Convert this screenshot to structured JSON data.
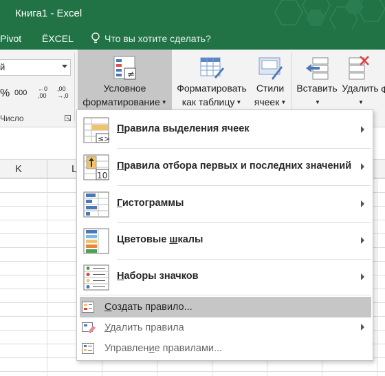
{
  "window": {
    "title": "Книга1 - Excel"
  },
  "tabs": {
    "pivot": "Pivot",
    "excel": "ЁXCEL",
    "tell_me": "Что вы хотите сделать?"
  },
  "ribbon": {
    "number_format_value": "й",
    "percent": "%",
    "thousands": "000",
    "inc_decimal": "←0 ,00",
    "dec_decimal": ",00 →,0",
    "number_group_label": "Число",
    "cond_format": {
      "line1": "Условное",
      "line2": "форматирование"
    },
    "format_table": {
      "line1": "Форматировать",
      "line2": "как таблицу"
    },
    "cell_styles": {
      "line1": "Стили",
      "line2": "ячеек"
    },
    "insert": {
      "label": "Вставить"
    },
    "delete": {
      "label": "Удалить"
    },
    "format": {
      "label": "Ф"
    }
  },
  "columns": [
    "K",
    "L"
  ],
  "menu": {
    "highlight_rules": {
      "label_u": "П",
      "label_rest": "равила выделения ячеек"
    },
    "top_bottom": {
      "label_u": "П",
      "label_rest": "равила отбора первых и последних значений"
    },
    "data_bars": {
      "label_u": "Г",
      "label_rest": "истограммы"
    },
    "color_scales": {
      "label_pre": "Цветовые ",
      "label_u": "ш",
      "label_rest": "калы"
    },
    "icon_sets": {
      "label_u": "Н",
      "label_rest": "аборы значков"
    },
    "new_rule": {
      "label_pre": "",
      "label_u": "С",
      "label_rest": "оздать правило..."
    },
    "clear_rules": {
      "label_u": "У",
      "label_rest": "далить правила"
    },
    "manage_rules": {
      "label_pre": "Управлен",
      "label_u": "и",
      "label_rest": "е правилами..."
    }
  },
  "colors": {
    "excel_green": "#217346",
    "ribbon_bg": "#f3f3f3",
    "highlight": "#c6c6c6"
  }
}
